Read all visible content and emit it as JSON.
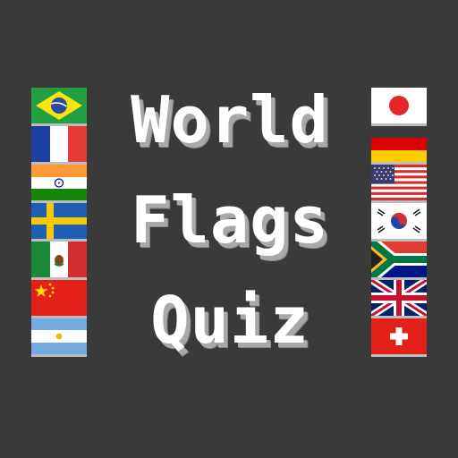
{
  "title": {
    "line1": "World",
    "line2": "Flags",
    "line3": "Quiz"
  },
  "left_flags": [
    "brazil-flag",
    "france-flag",
    "india-flag",
    "sweden-flag",
    "mexico-flag",
    "china-flag",
    "argentina-flag"
  ],
  "right_flags": [
    "japan-flag",
    "germany-flag",
    "usa-flag",
    "south-korea-flag",
    "south-africa-flag",
    "uk-flag",
    "switzerland-flag"
  ],
  "colors": {
    "background": "#3a3a3a",
    "title_text": "#ffffff",
    "title_shadow": "#a9a9a9"
  }
}
